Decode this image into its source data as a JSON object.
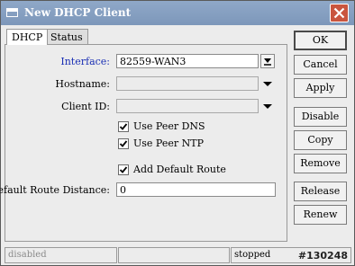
{
  "window": {
    "title": "New DHCP Client"
  },
  "tabs": [
    "DHCP",
    "Status"
  ],
  "form": {
    "interface": {
      "label": "Interface:",
      "value": "82559-WAN3"
    },
    "hostname": {
      "label": "Hostname:",
      "value": ""
    },
    "client_id": {
      "label": "Client ID:",
      "value": ""
    },
    "use_peer_dns": {
      "label": "Use Peer DNS",
      "checked": true
    },
    "use_peer_ntp": {
      "label": "Use Peer NTP",
      "checked": true
    },
    "add_default_route": {
      "label": "Add Default Route",
      "checked": true
    },
    "default_route_distance": {
      "label": "Default Route Distance:",
      "value": "0"
    }
  },
  "buttons": {
    "ok": "OK",
    "cancel": "Cancel",
    "apply": "Apply",
    "disable": "Disable",
    "copy": "Copy",
    "remove": "Remove",
    "release": "Release",
    "renew": "Renew"
  },
  "statusbar": {
    "left": "disabled",
    "middle": "",
    "right": "stopped"
  },
  "watermark": "#130248",
  "colors": {
    "titlebar": "#8ba5c7",
    "close_button": "#c9553f",
    "interface_label": "#1a2fb4"
  }
}
